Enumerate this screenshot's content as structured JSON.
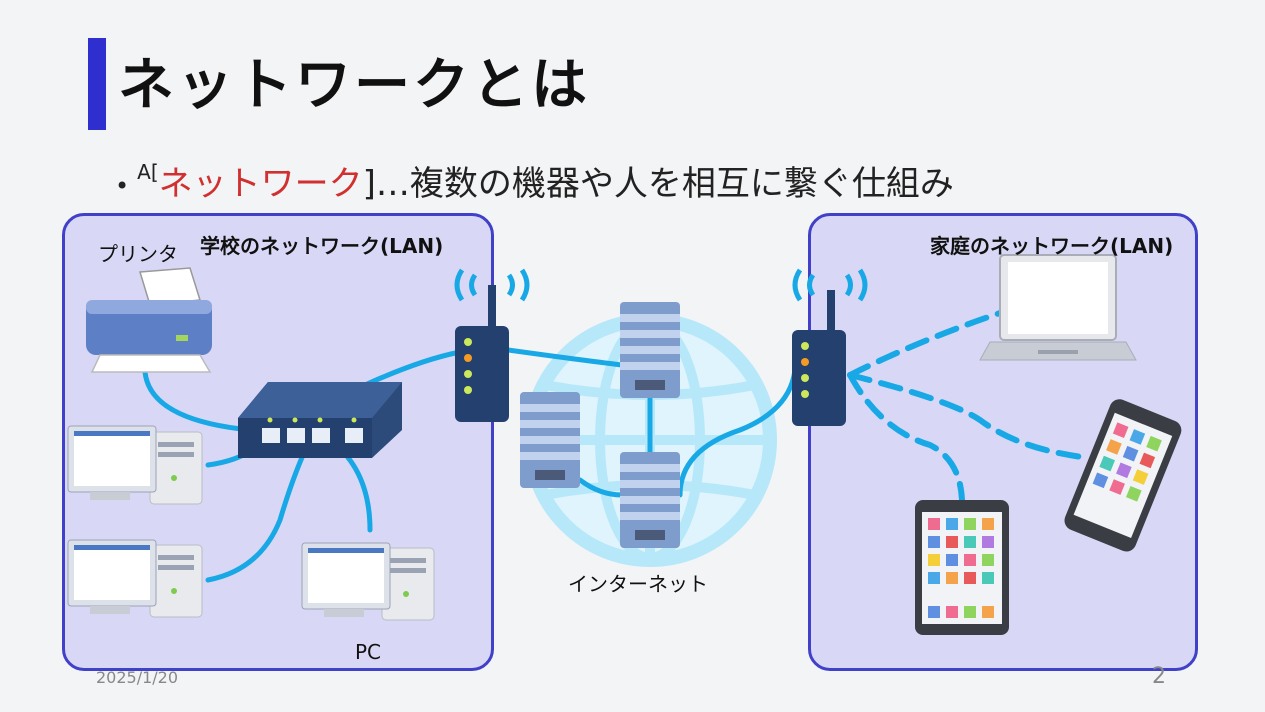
{
  "slide": {
    "title": "ネットワークとは",
    "bullet": {
      "prefix": "A[",
      "keyword": "ネットワーク",
      "suffix": "]…複数の機器や人を相互に繋ぐ仕組み"
    },
    "school_box_title": "学校のネットワーク(LAN)",
    "home_box_title": "家庭のネットワーク(LAN)",
    "labels": {
      "printer": "プリンタ",
      "pc": "PC",
      "internet": "インターネット"
    },
    "footer": {
      "date": "2025/1/20",
      "page": "2"
    },
    "colors": {
      "accent_bar": "#2f2fd0",
      "keyword": "#d03030",
      "box_border": "#4040c8",
      "box_fill": "#d8d8f6",
      "cable": "#19a8e6"
    }
  }
}
